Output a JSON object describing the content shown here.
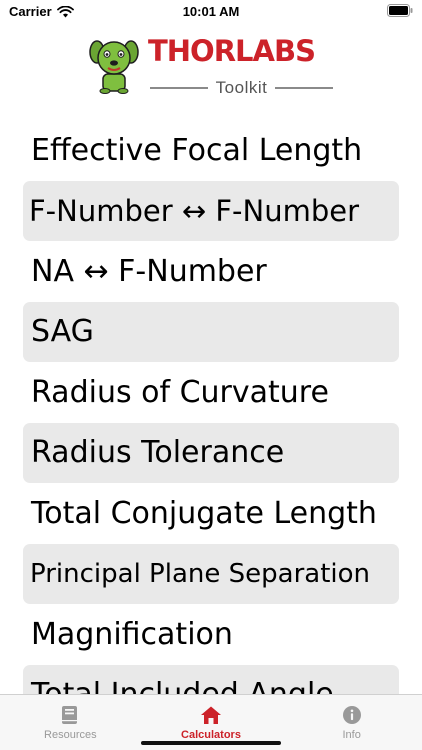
{
  "status_bar": {
    "carrier": "Carrier",
    "time": "10:01 AM"
  },
  "header": {
    "brand": "THORLABS",
    "subtitle": "Toolkit",
    "brand_color": "#cc2229",
    "mascot_color": "#7fbf3f"
  },
  "calculators": [
    {
      "label": "Effective Focal Length"
    },
    {
      "label": "F-Number ↔ F-Number"
    },
    {
      "label": "NA ↔ F-Number"
    },
    {
      "label": "SAG"
    },
    {
      "label": "Radius of Curvature"
    },
    {
      "label": "Radius Tolerance"
    },
    {
      "label": "Total Conjugate Length"
    },
    {
      "label": "Principal Plane Separation"
    },
    {
      "label": "Magnification"
    },
    {
      "label": "Total Included Angle"
    }
  ],
  "tab_bar": {
    "tabs": [
      {
        "label": "Resources",
        "icon": "book-icon",
        "active": false
      },
      {
        "label": "Calculators",
        "icon": "house-icon",
        "active": true
      },
      {
        "label": "Info",
        "icon": "info-icon",
        "active": false
      }
    ],
    "active_color": "#cc2229",
    "inactive_color": "#999999"
  }
}
